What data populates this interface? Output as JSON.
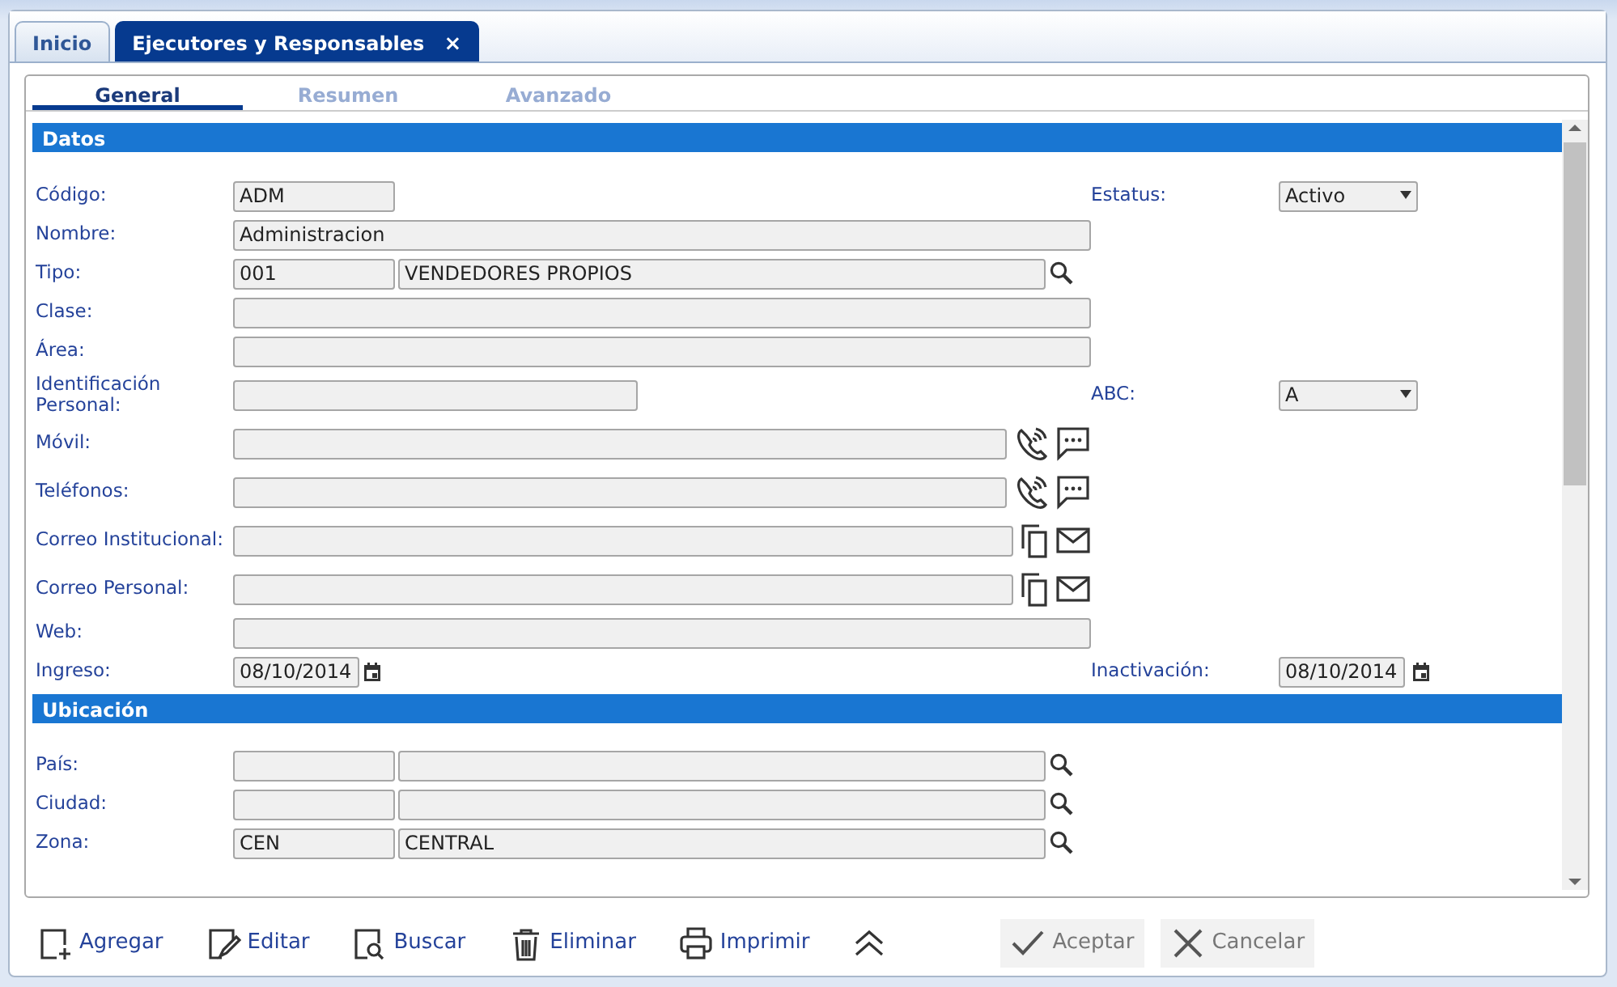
{
  "tabs": [
    {
      "label": "Inicio",
      "selected": false
    },
    {
      "label": "Ejecutores y Responsables",
      "selected": true,
      "close": "×"
    }
  ],
  "subtabs": [
    {
      "label": "General",
      "selected": true
    },
    {
      "label": "Resumen",
      "selected": false
    },
    {
      "label": "Avanzado",
      "selected": false
    }
  ],
  "sections": [
    {
      "title": "Datos",
      "rows": [
        {
          "label": "Código:",
          "kind": "plain",
          "fields": [
            {
              "kind": "code",
              "value": "ADM"
            }
          ],
          "right": {
            "label": "Estatus:",
            "kind": "select",
            "value": "Activo"
          }
        },
        {
          "label": "Nombre:",
          "kind": "plain",
          "fields": [
            {
              "kind": "long",
              "value": "Administracion"
            }
          ]
        },
        {
          "label": "Tipo:",
          "kind": "lookup",
          "fields": [
            {
              "kind": "code",
              "value": "001"
            },
            {
              "kind": "desc",
              "value": "VENDEDORES PROPIOS"
            }
          ]
        },
        {
          "label": "Clase:",
          "kind": "plain",
          "fields": [
            {
              "kind": "long"
            }
          ]
        },
        {
          "label": "Área:",
          "kind": "plain",
          "fields": [
            {
              "kind": "long"
            }
          ]
        },
        {
          "label": "Identificación Personal:",
          "kind": "plain",
          "fields": [
            {
              "kind": "medium"
            }
          ],
          "right": {
            "label": "ABC:",
            "kind": "select",
            "value": "A"
          }
        },
        {
          "label": "Móvil:",
          "kind": "phone",
          "fields": [
            {
              "kind": "wide"
            }
          ]
        },
        {
          "label": "Teléfonos:",
          "kind": "phone",
          "fields": [
            {
              "kind": "wide"
            }
          ]
        },
        {
          "label": "Correo Institucional:",
          "kind": "email",
          "fields": [
            {
              "kind": "wide"
            }
          ]
        },
        {
          "label": "Correo Personal:",
          "kind": "email",
          "fields": [
            {
              "kind": "wide"
            }
          ]
        },
        {
          "label": "Web:",
          "kind": "plain",
          "fields": [
            {
              "kind": "long"
            }
          ]
        },
        {
          "label": "Ingreso:",
          "kind": "date",
          "fields": [
            {
              "kind": "date",
              "value": "08/10/2014"
            }
          ],
          "right": {
            "label": "Inactivación:",
            "kind": "date",
            "value": "08/10/2014"
          }
        }
      ]
    },
    {
      "title": "Ubicación",
      "rows": [
        {
          "label": "País:",
          "kind": "lookup",
          "fields": [
            {
              "kind": "code"
            },
            {
              "kind": "desc"
            }
          ]
        },
        {
          "label": "Ciudad:",
          "kind": "lookup",
          "fields": [
            {
              "kind": "code"
            },
            {
              "kind": "desc"
            }
          ]
        },
        {
          "label": "Zona:",
          "kind": "lookup",
          "fields": [
            {
              "kind": "code",
              "value": "CEN"
            },
            {
              "kind": "desc",
              "value": "CENTRAL"
            }
          ]
        }
      ]
    }
  ],
  "toolbar": [
    {
      "label": "Agregar",
      "kind": "add",
      "disabled": false
    },
    {
      "label": "Editar",
      "kind": "edit",
      "disabled": false
    },
    {
      "label": "Buscar",
      "kind": "find",
      "disabled": false
    },
    {
      "label": "Eliminar",
      "kind": "delete",
      "disabled": false
    },
    {
      "label": "Imprimir",
      "kind": "print",
      "disabled": false
    },
    {
      "kind": "collapse",
      "disabled": false
    },
    {
      "label": "Aceptar",
      "kind": "accept",
      "disabled": true
    },
    {
      "label": "Cancelar",
      "kind": "cancel",
      "disabled": true
    }
  ]
}
